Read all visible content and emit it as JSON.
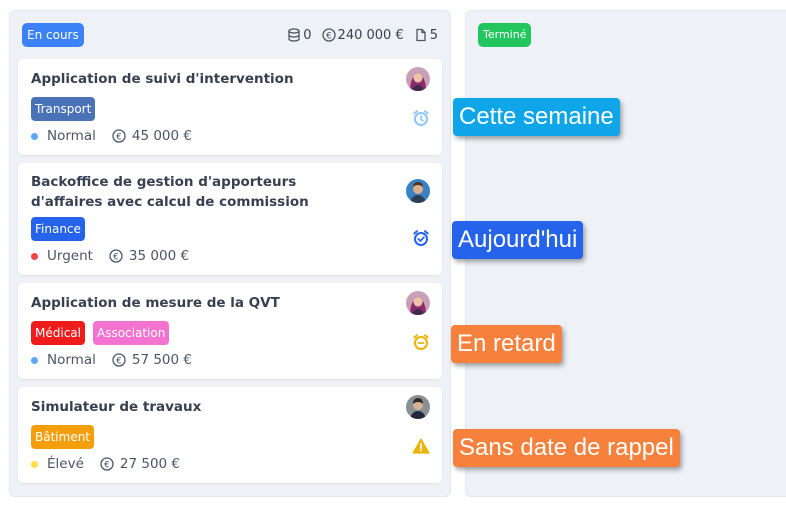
{
  "columns": [
    {
      "title": "En cours",
      "color": "#3b82f6",
      "stats": {
        "count_db": "0",
        "amount": "240 000 €",
        "count_docs": "5"
      },
      "cards": [
        {
          "title": "Application de suivi d'intervention",
          "tags": [
            {
              "label": "Transport",
              "color": "#4a72b7"
            }
          ],
          "priority": "Normal",
          "priority_color": "#60a5fa",
          "amount": "45 000 €",
          "alarm": "alarm-clock-icon",
          "alarm_color": "#93c5fd"
        },
        {
          "title": "Backoffice de gestion d'apporteurs d'affaires avec calcul de commission",
          "tags": [
            {
              "label": "Finance",
              "color": "#2563eb"
            }
          ],
          "priority": "Urgent",
          "priority_color": "#ef4444",
          "amount": "35 000 €",
          "alarm": "alarm-check-icon",
          "alarm_color": "#2563eb"
        },
        {
          "title": "Application de mesure de la QVT",
          "tags": [
            {
              "label": "Médical",
              "color": "#ef1c1c"
            },
            {
              "label": "Association",
              "color": "#f472d0"
            }
          ],
          "priority": "Normal",
          "priority_color": "#60a5fa",
          "amount": "57 500 €",
          "alarm": "alarm-minus-icon",
          "alarm_color": "#eab308"
        },
        {
          "title": "Simulateur de travaux",
          "tags": [
            {
              "label": "Bâtiment",
              "color": "#f59e0b"
            }
          ],
          "priority": "Élevé",
          "priority_color": "#fde047",
          "amount": "27 500 €",
          "alarm": "warning-icon",
          "alarm_color": "#eab308"
        }
      ]
    },
    {
      "title": "Terminé",
      "color": "#22c55e"
    }
  ],
  "legend": [
    {
      "label": "Cette semaine",
      "color": "#0ea5e9"
    },
    {
      "label": "Aujourd'hui",
      "color": "#2563eb"
    },
    {
      "label": "En retard",
      "color": "#f5813c"
    },
    {
      "label": "Sans date de rappel",
      "color": "#f5813c"
    }
  ]
}
